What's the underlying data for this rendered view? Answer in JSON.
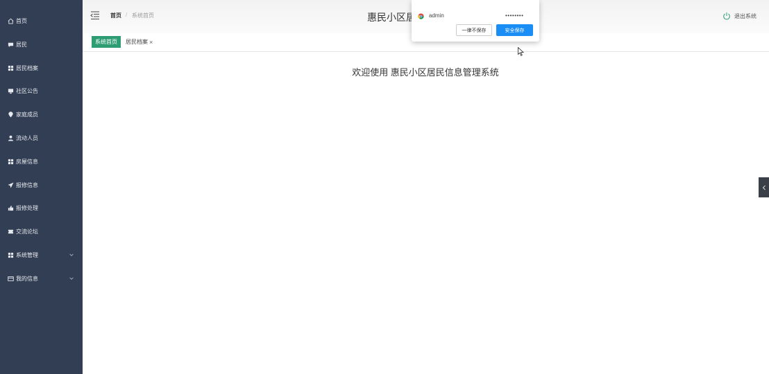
{
  "site_title": "惠民小区居",
  "breadcrumb": {
    "home": "首页",
    "separator": "/",
    "current": "系统首页"
  },
  "logout_label": "退出系统",
  "sidebar": {
    "items": [
      {
        "label": "首页",
        "icon": "home-icon"
      },
      {
        "label": "居民",
        "icon": "chat-icon"
      },
      {
        "label": "居民档案",
        "icon": "grid-icon"
      },
      {
        "label": "社区公告",
        "icon": "monitor-icon"
      },
      {
        "label": "家庭成员",
        "icon": "location-icon"
      },
      {
        "label": "流动人员",
        "icon": "user-icon"
      },
      {
        "label": "房屋信息",
        "icon": "grid-icon"
      },
      {
        "label": "报修信息",
        "icon": "send-icon"
      },
      {
        "label": "报修处理",
        "icon": "thumb-icon"
      },
      {
        "label": "交流论坛",
        "icon": "ticket-icon"
      },
      {
        "label": "系统管理",
        "icon": "grid-icon",
        "expandable": true
      },
      {
        "label": "我的信息",
        "icon": "card-icon",
        "expandable": true
      }
    ]
  },
  "tabs": {
    "active": "系统首页",
    "other": "居民档案",
    "close_glyph": "×"
  },
  "welcome_text": "欢迎使用 惠民小区居民信息管理系统",
  "password_popup": {
    "username": "admin",
    "password_mask": "••••••••",
    "never_button": "一律不保存",
    "save_button": "安全保存"
  },
  "colors": {
    "sidebar_bg": "#323e53",
    "active_tab": "#2f9d74",
    "save_button": "#1a8ef5",
    "power_icon": "#2f9d74"
  }
}
